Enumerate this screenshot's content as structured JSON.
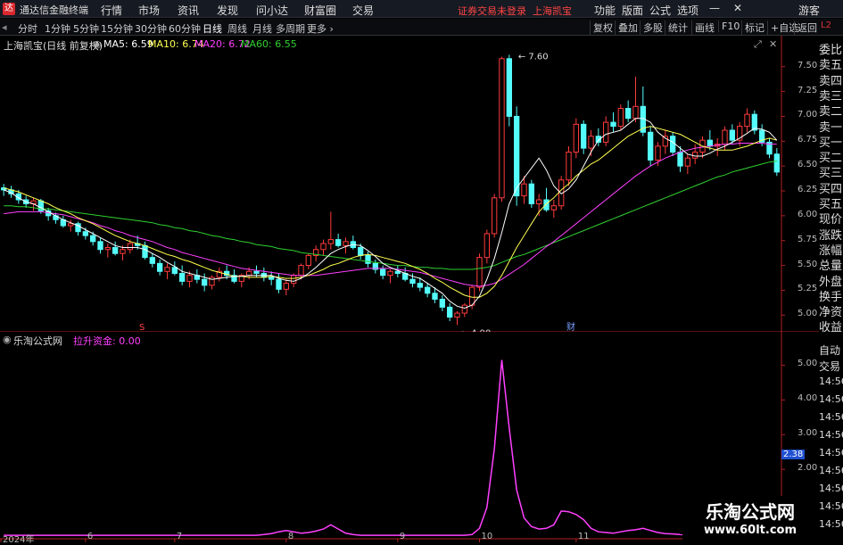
{
  "app": {
    "title": "通达信金融终端",
    "logo_char": "达"
  },
  "menu": [
    "行情",
    "市场",
    "资讯",
    "发现",
    "问小达",
    "财富圈",
    "交易"
  ],
  "notice": {
    "text": "证券交易未登录",
    "stock": "上海凯宝"
  },
  "menu_right": [
    "功能",
    "版面",
    "公式",
    "选项",
    "游客"
  ],
  "periods": [
    "分时",
    "1分钟",
    "5分钟",
    "15分钟",
    "30分钟",
    "60分钟",
    "日线",
    "周线",
    "月线",
    "多周期",
    "更多"
  ],
  "active_period": "日线",
  "toolbar_right": [
    "复权",
    "叠加",
    "多股",
    "统计",
    "画线",
    "F10",
    "标记",
    "+自选",
    "返回"
  ],
  "stock_header": {
    "name": "上海凯宝(日线 前复权)",
    "ma5": "MA5: 6.59",
    "ma10": "MA10: 6.74",
    "ma20": "MA20: 6.72",
    "ma60": "MA60: 6.55"
  },
  "colors": {
    "up": "#ff3b3b",
    "down": "#54fcfc",
    "ma5": "#ffffff",
    "ma10": "#ffff4f",
    "ma20": "#ff40ff",
    "ma60": "#30d030",
    "indicator": "#ff40ff"
  },
  "price_axis": [
    "7.50",
    "7.25",
    "7.00",
    "6.75",
    "6.50",
    "6.25",
    "6.00",
    "5.75",
    "5.50",
    "5.25",
    "5.00"
  ],
  "annotations": {
    "high": "7.60",
    "low": "4.90",
    "marker_s": "S",
    "marker_cai": "财"
  },
  "side_panel": [
    "委比",
    "卖五",
    "卖四",
    "卖三",
    "卖二",
    "卖一",
    "买一",
    "买二",
    "买三",
    "买四",
    "买五",
    "现价",
    "涨跌",
    "涨幅",
    "总量",
    "外盘",
    "换手",
    "净资",
    "收益"
  ],
  "indicator": {
    "name": "乐淘公式网",
    "label": "拉升资金: 0.00",
    "current": "2.38",
    "axis": [
      "5.00",
      "4.00",
      "3.00",
      "2.00"
    ]
  },
  "side_panel_lower": {
    "auto": "自动",
    "trade": "交易",
    "times": [
      "14:56",
      "14:56",
      "14:56",
      "14:56",
      "14:56",
      "14:56",
      "14:56",
      "14:56",
      "14:56"
    ]
  },
  "date_axis": [
    "2024年",
    "6",
    "7",
    "8",
    "9",
    "10",
    "11"
  ],
  "watermark": {
    "line1": "乐淘公式网",
    "line2": "www.60lt.com"
  },
  "chart_data": {
    "type": "candlestick",
    "ylim": [
      4.85,
      7.65
    ],
    "candles": [
      [
        6.28,
        6.32,
        6.2,
        6.26
      ],
      [
        6.26,
        6.3,
        6.18,
        6.22
      ],
      [
        6.22,
        6.26,
        6.12,
        6.16
      ],
      [
        6.16,
        6.2,
        6.08,
        6.12
      ],
      [
        6.12,
        6.18,
        6.05,
        6.15
      ],
      [
        6.15,
        6.17,
        6.02,
        6.05
      ],
      [
        6.05,
        6.08,
        5.95,
        6.0
      ],
      [
        6.0,
        6.03,
        5.92,
        5.96
      ],
      [
        5.96,
        6.0,
        5.88,
        5.9
      ],
      [
        5.9,
        5.96,
        5.84,
        5.92
      ],
      [
        5.92,
        5.94,
        5.8,
        5.84
      ],
      [
        5.84,
        5.88,
        5.76,
        5.8
      ],
      [
        5.8,
        5.84,
        5.7,
        5.74
      ],
      [
        5.74,
        5.78,
        5.62,
        5.66
      ],
      [
        5.66,
        5.72,
        5.58,
        5.68
      ],
      [
        5.68,
        5.74,
        5.6,
        5.62
      ],
      [
        5.62,
        5.7,
        5.55,
        5.66
      ],
      [
        5.66,
        5.76,
        5.62,
        5.72
      ],
      [
        5.72,
        5.8,
        5.66,
        5.7
      ],
      [
        5.7,
        5.74,
        5.56,
        5.58
      ],
      [
        5.58,
        5.62,
        5.48,
        5.52
      ],
      [
        5.52,
        5.56,
        5.4,
        5.44
      ],
      [
        5.44,
        5.52,
        5.36,
        5.48
      ],
      [
        5.48,
        5.54,
        5.4,
        5.42
      ],
      [
        5.42,
        5.5,
        5.3,
        5.34
      ],
      [
        5.34,
        5.44,
        5.28,
        5.4
      ],
      [
        5.4,
        5.46,
        5.32,
        5.36
      ],
      [
        5.36,
        5.42,
        5.24,
        5.3
      ],
      [
        5.3,
        5.4,
        5.26,
        5.38
      ],
      [
        5.38,
        5.48,
        5.34,
        5.44
      ],
      [
        5.44,
        5.5,
        5.36,
        5.4
      ],
      [
        5.4,
        5.46,
        5.32,
        5.34
      ],
      [
        5.34,
        5.42,
        5.28,
        5.4
      ],
      [
        5.4,
        5.48,
        5.36,
        5.44
      ],
      [
        5.44,
        5.5,
        5.38,
        5.42
      ],
      [
        5.42,
        5.48,
        5.34,
        5.38
      ],
      [
        5.38,
        5.44,
        5.3,
        5.36
      ],
      [
        5.36,
        5.42,
        5.22,
        5.26
      ],
      [
        5.26,
        5.36,
        5.2,
        5.32
      ],
      [
        5.32,
        5.42,
        5.28,
        5.4
      ],
      [
        5.4,
        5.52,
        5.36,
        5.5
      ],
      [
        5.5,
        5.62,
        5.46,
        5.6
      ],
      [
        5.6,
        5.7,
        5.54,
        5.66
      ],
      [
        5.66,
        5.76,
        5.6,
        5.72
      ],
      [
        5.72,
        6.04,
        5.66,
        5.76
      ],
      [
        5.76,
        5.82,
        5.68,
        5.7
      ],
      [
        5.7,
        5.78,
        5.62,
        5.74
      ],
      [
        5.74,
        5.8,
        5.66,
        5.68
      ],
      [
        5.68,
        5.72,
        5.56,
        5.6
      ],
      [
        5.6,
        5.64,
        5.48,
        5.52
      ],
      [
        5.52,
        5.56,
        5.42,
        5.46
      ],
      [
        5.46,
        5.5,
        5.36,
        5.4
      ],
      [
        5.4,
        5.46,
        5.32,
        5.44
      ],
      [
        5.44,
        5.5,
        5.38,
        5.42
      ],
      [
        5.42,
        5.48,
        5.34,
        5.36
      ],
      [
        5.36,
        5.42,
        5.28,
        5.32
      ],
      [
        5.32,
        5.38,
        5.24,
        5.28
      ],
      [
        5.28,
        5.32,
        5.18,
        5.22
      ],
      [
        5.22,
        5.28,
        5.12,
        5.16
      ],
      [
        5.16,
        5.2,
        5.04,
        5.08
      ],
      [
        5.08,
        5.12,
        4.94,
        4.98
      ],
      [
        4.98,
        5.04,
        4.9,
        5.02
      ],
      [
        5.02,
        5.12,
        4.98,
        5.1
      ],
      [
        5.1,
        5.3,
        5.06,
        5.28
      ],
      [
        5.28,
        5.62,
        5.24,
        5.58
      ],
      [
        5.58,
        5.86,
        5.52,
        5.82
      ],
      [
        5.82,
        6.22,
        5.78,
        6.18
      ],
      [
        6.18,
        7.6,
        6.14,
        7.58
      ],
      [
        7.58,
        7.62,
        6.9,
        7.0
      ],
      [
        7.0,
        7.1,
        6.1,
        6.2
      ],
      [
        6.2,
        6.4,
        6.12,
        6.32
      ],
      [
        6.32,
        6.36,
        6.08,
        6.12
      ],
      [
        6.12,
        6.22,
        6.0,
        6.16
      ],
      [
        6.16,
        6.28,
        6.04,
        6.06
      ],
      [
        6.06,
        6.16,
        5.98,
        6.1
      ],
      [
        6.1,
        6.4,
        6.06,
        6.36
      ],
      [
        6.36,
        6.7,
        6.3,
        6.64
      ],
      [
        6.64,
        6.98,
        6.58,
        6.92
      ],
      [
        6.92,
        6.96,
        6.62,
        6.68
      ],
      [
        6.68,
        6.86,
        6.6,
        6.8
      ],
      [
        6.8,
        6.88,
        6.7,
        6.74
      ],
      [
        6.74,
        7.0,
        6.7,
        6.94
      ],
      [
        6.94,
        7.04,
        6.84,
        6.9
      ],
      [
        6.9,
        7.12,
        6.86,
        7.08
      ],
      [
        7.08,
        7.16,
        6.94,
        6.98
      ],
      [
        6.98,
        7.4,
        6.94,
        7.1
      ],
      [
        7.1,
        7.3,
        6.8,
        6.84
      ],
      [
        6.84,
        6.9,
        6.5,
        6.56
      ],
      [
        6.56,
        6.74,
        6.5,
        6.7
      ],
      [
        6.7,
        6.86,
        6.62,
        6.8
      ],
      [
        6.8,
        6.84,
        6.6,
        6.64
      ],
      [
        6.64,
        6.7,
        6.44,
        6.5
      ],
      [
        6.5,
        6.62,
        6.42,
        6.58
      ],
      [
        6.58,
        6.72,
        6.52,
        6.64
      ],
      [
        6.64,
        6.8,
        6.58,
        6.76
      ],
      [
        6.76,
        6.86,
        6.66,
        6.7
      ],
      [
        6.7,
        6.78,
        6.6,
        6.72
      ],
      [
        6.72,
        6.9,
        6.66,
        6.86
      ],
      [
        6.86,
        6.92,
        6.72,
        6.76
      ],
      [
        6.76,
        6.94,
        6.7,
        6.9
      ],
      [
        6.9,
        7.08,
        6.84,
        7.02
      ],
      [
        7.02,
        7.06,
        6.82,
        6.86
      ],
      [
        6.86,
        6.92,
        6.7,
        6.74
      ],
      [
        6.74,
        6.78,
        6.58,
        6.62
      ],
      [
        6.62,
        6.68,
        6.4,
        6.44
      ]
    ],
    "ma5": [
      6.26,
      6.23,
      6.18,
      6.14,
      6.12,
      6.08,
      6.04,
      6.0,
      5.96,
      5.93,
      5.9,
      5.86,
      5.82,
      5.78,
      5.74,
      5.7,
      5.68,
      5.68,
      5.68,
      5.66,
      5.62,
      5.58,
      5.53,
      5.49,
      5.44,
      5.42,
      5.4,
      5.38,
      5.36,
      5.37,
      5.38,
      5.39,
      5.39,
      5.4,
      5.4,
      5.4,
      5.4,
      5.37,
      5.35,
      5.34,
      5.37,
      5.42,
      5.48,
      5.55,
      5.62,
      5.66,
      5.69,
      5.71,
      5.7,
      5.65,
      5.59,
      5.52,
      5.48,
      5.45,
      5.42,
      5.39,
      5.37,
      5.32,
      5.27,
      5.22,
      5.14,
      5.09,
      5.07,
      5.1,
      5.19,
      5.36,
      5.57,
      5.83,
      6.12,
      6.28,
      6.38,
      6.48,
      6.58,
      6.46,
      6.3,
      6.22,
      6.27,
      6.36,
      6.5,
      6.64,
      6.76,
      6.82,
      6.84,
      6.86,
      6.92,
      6.98,
      6.98,
      6.94,
      6.84,
      6.78,
      6.74,
      6.68,
      6.62,
      6.6,
      6.6,
      6.63,
      6.67,
      6.7,
      6.74,
      6.78,
      6.83,
      6.88,
      6.87,
      6.84,
      6.76
    ],
    "ma10": [
      6.28,
      6.26,
      6.24,
      6.21,
      6.18,
      6.15,
      6.12,
      6.08,
      6.05,
      6.02,
      5.98,
      5.95,
      5.92,
      5.88,
      5.84,
      5.8,
      5.77,
      5.74,
      5.72,
      5.7,
      5.67,
      5.64,
      5.61,
      5.59,
      5.56,
      5.54,
      5.51,
      5.48,
      5.45,
      5.43,
      5.41,
      5.39,
      5.39,
      5.38,
      5.38,
      5.38,
      5.39,
      5.38,
      5.37,
      5.37,
      5.38,
      5.4,
      5.43,
      5.46,
      5.5,
      5.52,
      5.55,
      5.58,
      5.6,
      5.61,
      5.6,
      5.58,
      5.56,
      5.54,
      5.52,
      5.49,
      5.46,
      5.42,
      5.37,
      5.33,
      5.28,
      5.24,
      5.2,
      5.18,
      5.18,
      5.22,
      5.29,
      5.4,
      5.54,
      5.68,
      5.8,
      5.92,
      6.04,
      6.12,
      6.18,
      6.26,
      6.32,
      6.4,
      6.46,
      6.52,
      6.56,
      6.62,
      6.68,
      6.74,
      6.8,
      6.84,
      6.88,
      6.9,
      6.88,
      6.86,
      6.84,
      6.82,
      6.78,
      6.74,
      6.7,
      6.68,
      6.66,
      6.66,
      6.66,
      6.68,
      6.7,
      6.73,
      6.76,
      6.78,
      6.76
    ],
    "ma20": [
      6.02,
      6.03,
      6.04,
      6.04,
      6.04,
      6.04,
      6.03,
      6.02,
      6.01,
      5.99,
      5.97,
      5.95,
      5.93,
      5.9,
      5.88,
      5.85,
      5.83,
      5.8,
      5.78,
      5.76,
      5.74,
      5.71,
      5.68,
      5.66,
      5.63,
      5.61,
      5.59,
      5.57,
      5.55,
      5.53,
      5.51,
      5.49,
      5.47,
      5.46,
      5.45,
      5.44,
      5.43,
      5.42,
      5.41,
      5.4,
      5.4,
      5.4,
      5.4,
      5.41,
      5.42,
      5.43,
      5.44,
      5.45,
      5.46,
      5.47,
      5.47,
      5.47,
      5.47,
      5.46,
      5.45,
      5.44,
      5.43,
      5.41,
      5.39,
      5.37,
      5.35,
      5.33,
      5.31,
      5.3,
      5.29,
      5.3,
      5.32,
      5.36,
      5.41,
      5.46,
      5.51,
      5.57,
      5.63,
      5.69,
      5.74,
      5.8,
      5.86,
      5.92,
      5.98,
      6.04,
      6.1,
      6.16,
      6.22,
      6.28,
      6.34,
      6.4,
      6.45,
      6.5,
      6.54,
      6.58,
      6.61,
      6.64,
      6.66,
      6.68,
      6.69,
      6.7,
      6.71,
      6.72,
      6.72,
      6.73,
      6.73,
      6.73,
      6.73,
      6.72,
      6.72
    ],
    "ma60": [
      6.1,
      6.1,
      6.09,
      6.09,
      6.08,
      6.07,
      6.07,
      6.06,
      6.05,
      6.04,
      6.03,
      6.02,
      6.01,
      6.0,
      5.99,
      5.98,
      5.97,
      5.96,
      5.95,
      5.94,
      5.93,
      5.91,
      5.9,
      5.88,
      5.87,
      5.85,
      5.84,
      5.82,
      5.8,
      5.79,
      5.77,
      5.76,
      5.74,
      5.73,
      5.71,
      5.7,
      5.69,
      5.67,
      5.66,
      5.65,
      5.63,
      5.62,
      5.61,
      5.6,
      5.59,
      5.58,
      5.57,
      5.56,
      5.55,
      5.54,
      5.53,
      5.52,
      5.51,
      5.5,
      5.5,
      5.49,
      5.48,
      5.48,
      5.47,
      5.47,
      5.46,
      5.46,
      5.46,
      5.46,
      5.47,
      5.48,
      5.5,
      5.53,
      5.56,
      5.59,
      5.61,
      5.64,
      5.67,
      5.7,
      5.73,
      5.76,
      5.79,
      5.82,
      5.85,
      5.88,
      5.91,
      5.94,
      5.97,
      6.0,
      6.03,
      6.06,
      6.09,
      6.12,
      6.15,
      6.18,
      6.21,
      6.24,
      6.27,
      6.3,
      6.33,
      6.36,
      6.39,
      6.41,
      6.44,
      6.46,
      6.48,
      6.5,
      6.52,
      6.54,
      6.55
    ],
    "indicator_ylim": [
      0.0,
      5.5
    ],
    "indicator_values": [
      0.1,
      0.1,
      0.1,
      0.1,
      0.1,
      0.1,
      0.1,
      0.1,
      0.1,
      0.1,
      0.1,
      0.1,
      0.1,
      0.1,
      0.1,
      0.1,
      0.1,
      0.1,
      0.1,
      0.1,
      0.1,
      0.1,
      0.1,
      0.1,
      0.1,
      0.1,
      0.1,
      0.1,
      0.1,
      0.1,
      0.1,
      0.1,
      0.1,
      0.1,
      0.1,
      0.12,
      0.15,
      0.2,
      0.24,
      0.2,
      0.16,
      0.18,
      0.22,
      0.28,
      0.4,
      0.28,
      0.16,
      0.12,
      0.1,
      0.1,
      0.1,
      0.1,
      0.1,
      0.1,
      0.1,
      0.1,
      0.1,
      0.1,
      0.1,
      0.1,
      0.1,
      0.1,
      0.1,
      0.12,
      0.3,
      0.9,
      2.6,
      5.15,
      3.2,
      1.4,
      0.6,
      0.35,
      0.28,
      0.3,
      0.4,
      0.8,
      0.78,
      0.7,
      0.55,
      0.3,
      0.2,
      0.18,
      0.16,
      0.2,
      0.24,
      0.26,
      0.3,
      0.24,
      0.18,
      0.15,
      0.14,
      0.12,
      0.11,
      0.11,
      0.11,
      0.11,
      0.11,
      0.11,
      0.11,
      0.1,
      0.1,
      0.1,
      0.1,
      0.1,
      0.1
    ]
  }
}
